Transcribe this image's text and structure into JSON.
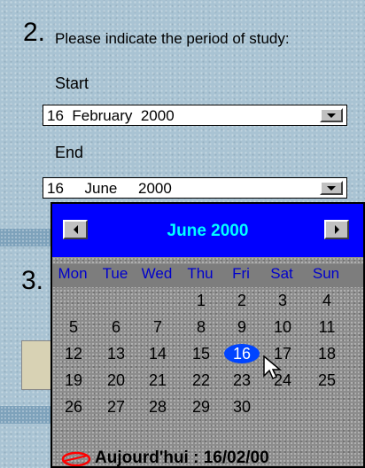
{
  "question": {
    "number": "2.",
    "text": "Please indicate the period of study:"
  },
  "start": {
    "label": "Start",
    "value": "16  February  2000"
  },
  "end": {
    "label": "End",
    "value": "16     June     2000"
  },
  "next_question_number": "3.",
  "calendar": {
    "title": "June 2000",
    "weekdays": [
      "Mon",
      "Tue",
      "Wed",
      "Thu",
      "Fri",
      "Sat",
      "Sun"
    ],
    "weeks": [
      [
        "",
        "",
        "",
        "1",
        "2",
        "3",
        "4"
      ],
      [
        "5",
        "6",
        "7",
        "8",
        "9",
        "10",
        "11"
      ],
      [
        "12",
        "13",
        "14",
        "15",
        "16",
        "17",
        "18"
      ],
      [
        "19",
        "20",
        "21",
        "22",
        "23",
        "24",
        "25"
      ],
      [
        "26",
        "27",
        "28",
        "29",
        "30",
        "",
        ""
      ]
    ],
    "selected_day": "16",
    "today_label": "Aujourd'hui : 16/02/00",
    "colors": {
      "header": "#0000ff",
      "title": "#00ffff",
      "weekday": "#0000cc",
      "selected": "#0044ff",
      "today_icon": "#ff0000"
    }
  }
}
